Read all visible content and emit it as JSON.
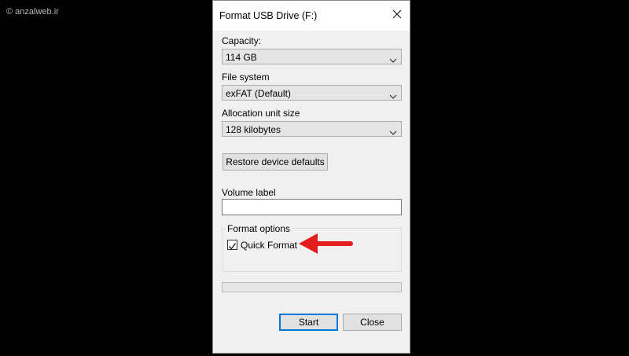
{
  "watermark": "© anzalweb.ir",
  "dialog": {
    "title": "Format USB Drive (F:)",
    "capacity": {
      "label": "Capacity:",
      "value": "114 GB"
    },
    "file_system": {
      "label": "File system",
      "value": "exFAT (Default)"
    },
    "allocation": {
      "label": "Allocation unit size",
      "value": "128 kilobytes"
    },
    "restore_button": "Restore device defaults",
    "volume_label": {
      "label": "Volume label",
      "value": ""
    },
    "format_options": {
      "title": "Format options",
      "quick_format": {
        "label": "Quick Format",
        "checked": true
      }
    },
    "progress": 0,
    "start_button": "Start",
    "close_button": "Close"
  },
  "colors": {
    "background": "#000000",
    "dialog_bg": "#f0f0f0",
    "button_bg": "#e1e1e1",
    "default_button_border": "#0078d7",
    "annotation_arrow": "#e41d1d"
  },
  "icons": [
    "close-icon",
    "chevron-down-icon",
    "checkmark-icon",
    "annotation-arrow-icon"
  ]
}
